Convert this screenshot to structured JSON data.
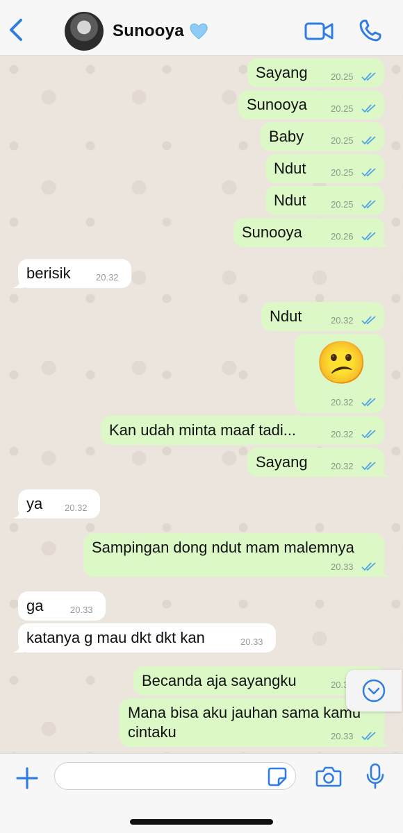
{
  "header": {
    "contact_name": "Sunooya",
    "back_icon": "chevron-left-icon",
    "heart_icon": "blue-heart-emoji",
    "video_icon": "video-camera-icon",
    "call_icon": "phone-icon",
    "accent_color": "#2f7de1"
  },
  "messages": [
    {
      "dir": "out",
      "text": "Sayang",
      "time": "20.25",
      "read": true
    },
    {
      "dir": "out",
      "text": "Sunooya",
      "time": "20.25",
      "read": true
    },
    {
      "dir": "out",
      "text": "Baby",
      "time": "20.25",
      "read": true
    },
    {
      "dir": "out",
      "text": "Ndut",
      "time": "20.25",
      "read": true
    },
    {
      "dir": "out",
      "text": "Ndut",
      "time": "20.25",
      "read": true
    },
    {
      "dir": "out",
      "text": "Sunooya",
      "time": "20.26",
      "read": true
    },
    {
      "dir": "in",
      "text": "berisik",
      "time": "20.32"
    },
    {
      "dir": "out",
      "text": "Ndut",
      "time": "20.32",
      "read": true
    },
    {
      "dir": "out",
      "text": "😕",
      "time": "20.32",
      "read": true
    },
    {
      "dir": "out",
      "text": "Kan udah minta maaf tadi...",
      "time": "20.32",
      "read": true
    },
    {
      "dir": "out",
      "text": "Sayang",
      "time": "20.32",
      "read": true
    },
    {
      "dir": "in",
      "text": "ya",
      "time": "20.32"
    },
    {
      "dir": "out",
      "text": "Sampingan dong ndut mam malemnya",
      "time": "20.33",
      "read": true
    },
    {
      "dir": "in",
      "text": "ga",
      "time": "20.33"
    },
    {
      "dir": "in",
      "text": "katanya g mau dkt dkt kan",
      "time": "20.33"
    },
    {
      "dir": "out",
      "text": "Becanda aja sayangku",
      "time": "20.33",
      "read": true
    },
    {
      "dir": "out",
      "text_lines": [
        "Mana bisa aku jauhan sama kamu",
        "cintaku"
      ],
      "time": "20.33",
      "read": true
    }
  ],
  "colors": {
    "outgoing_bubble": "#dcf8c6",
    "incoming_bubble": "#ffffff",
    "read_ticks": "#4fa3e6",
    "chat_background": "#ece5dd"
  },
  "scroll_down_icon": "chevron-down-circle-icon",
  "composer": {
    "placeholder": "",
    "plus_icon": "plus-icon",
    "sticker_icon": "sticker-icon",
    "camera_icon": "camera-icon",
    "mic_icon": "microphone-icon"
  }
}
